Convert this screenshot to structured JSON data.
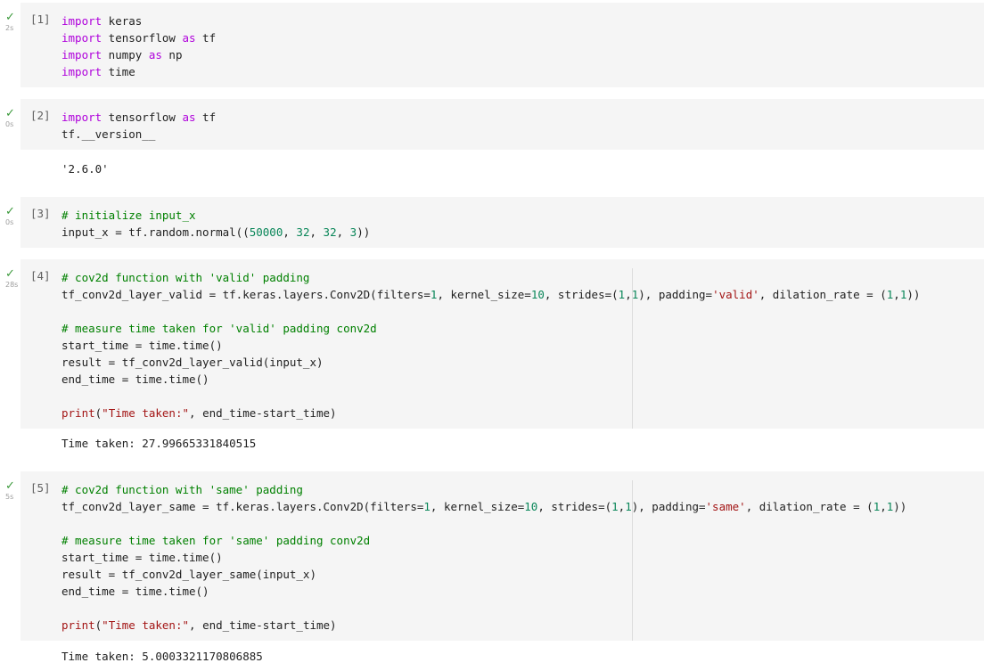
{
  "cells": [
    {
      "exec_count": "[1]",
      "duration": "2s",
      "lines": [
        [
          {
            "t": "import",
            "c": "kw"
          },
          {
            "t": " keras"
          }
        ],
        [
          {
            "t": "import",
            "c": "kw"
          },
          {
            "t": " tensorflow "
          },
          {
            "t": "as",
            "c": "kw"
          },
          {
            "t": " tf"
          }
        ],
        [
          {
            "t": "import",
            "c": "kw"
          },
          {
            "t": " numpy "
          },
          {
            "t": "as",
            "c": "kw"
          },
          {
            "t": " np"
          }
        ],
        [
          {
            "t": "import",
            "c": "kw"
          },
          {
            "t": " time"
          }
        ]
      ],
      "output": ""
    },
    {
      "exec_count": "[2]",
      "duration": "0s",
      "lines": [
        [
          {
            "t": "import",
            "c": "kw"
          },
          {
            "t": " tensorflow "
          },
          {
            "t": "as",
            "c": "kw"
          },
          {
            "t": " tf"
          }
        ],
        [
          {
            "t": "tf.__version__"
          }
        ]
      ],
      "output": "'2.6.0'"
    },
    {
      "exec_count": "[3]",
      "duration": "0s",
      "lines": [
        [
          {
            "t": "# initialize input_x",
            "c": "cm"
          }
        ],
        [
          {
            "t": "input_x = tf.random.normal(("
          },
          {
            "t": "50000",
            "c": "num"
          },
          {
            "t": ", "
          },
          {
            "t": "32",
            "c": "num"
          },
          {
            "t": ", "
          },
          {
            "t": "32",
            "c": "num"
          },
          {
            "t": ", "
          },
          {
            "t": "3",
            "c": "num"
          },
          {
            "t": "))"
          }
        ]
      ],
      "output": ""
    },
    {
      "exec_count": "[4]",
      "duration": "28s",
      "lines": [
        [
          {
            "t": "# cov2d function with 'valid' padding",
            "c": "cm"
          }
        ],
        [
          {
            "t": "tf_conv2d_layer_valid = tf.keras.layers.Conv2D(filters="
          },
          {
            "t": "1",
            "c": "num"
          },
          {
            "t": ", kernel_size="
          },
          {
            "t": "10",
            "c": "num"
          },
          {
            "t": ", strides=("
          },
          {
            "t": "1",
            "c": "num"
          },
          {
            "t": ","
          },
          {
            "t": "1",
            "c": "num"
          },
          {
            "t": "), padding="
          },
          {
            "t": "'valid'",
            "c": "str"
          },
          {
            "t": ", dilation_rate = ("
          },
          {
            "t": "1",
            "c": "num"
          },
          {
            "t": ","
          },
          {
            "t": "1",
            "c": "num"
          },
          {
            "t": "))"
          }
        ],
        [
          {
            "t": ""
          }
        ],
        [
          {
            "t": "# measure time taken for 'valid' padding conv2d",
            "c": "cm"
          }
        ],
        [
          {
            "t": "start_time = time.time()"
          }
        ],
        [
          {
            "t": "result = tf_conv2d_layer_valid(input_x)"
          }
        ],
        [
          {
            "t": "end_time = time.time()"
          }
        ],
        [
          {
            "t": ""
          }
        ],
        [
          {
            "t": "print",
            "c": "str"
          },
          {
            "t": "("
          },
          {
            "t": "\"Time taken:\"",
            "c": "str"
          },
          {
            "t": ", end_time-start_time)"
          }
        ]
      ],
      "output": "Time taken: 27.99665331840515"
    },
    {
      "exec_count": "[5]",
      "duration": "5s",
      "lines": [
        [
          {
            "t": "# cov2d function with 'same' padding",
            "c": "cm"
          }
        ],
        [
          {
            "t": "tf_conv2d_layer_same = tf.keras.layers.Conv2D(filters="
          },
          {
            "t": "1",
            "c": "num"
          },
          {
            "t": ", kernel_size="
          },
          {
            "t": "10",
            "c": "num"
          },
          {
            "t": ", strides=("
          },
          {
            "t": "1",
            "c": "num"
          },
          {
            "t": ","
          },
          {
            "t": "1",
            "c": "num"
          },
          {
            "t": "), padding="
          },
          {
            "t": "'same'",
            "c": "str"
          },
          {
            "t": ", dilation_rate = ("
          },
          {
            "t": "1",
            "c": "num"
          },
          {
            "t": ","
          },
          {
            "t": "1",
            "c": "num"
          },
          {
            "t": "))"
          }
        ],
        [
          {
            "t": ""
          }
        ],
        [
          {
            "t": "# measure time taken for 'same' padding conv2d",
            "c": "cm"
          }
        ],
        [
          {
            "t": "start_time = time.time()"
          }
        ],
        [
          {
            "t": "result = tf_conv2d_layer_same(input_x)"
          }
        ],
        [
          {
            "t": "end_time = time.time()"
          }
        ],
        [
          {
            "t": ""
          }
        ],
        [
          {
            "t": "print",
            "c": "str"
          },
          {
            "t": "("
          },
          {
            "t": "\"Time taken:\"",
            "c": "str"
          },
          {
            "t": ", end_time-start_time)"
          }
        ]
      ],
      "output": "Time taken: 5.0003321170806885"
    }
  ]
}
